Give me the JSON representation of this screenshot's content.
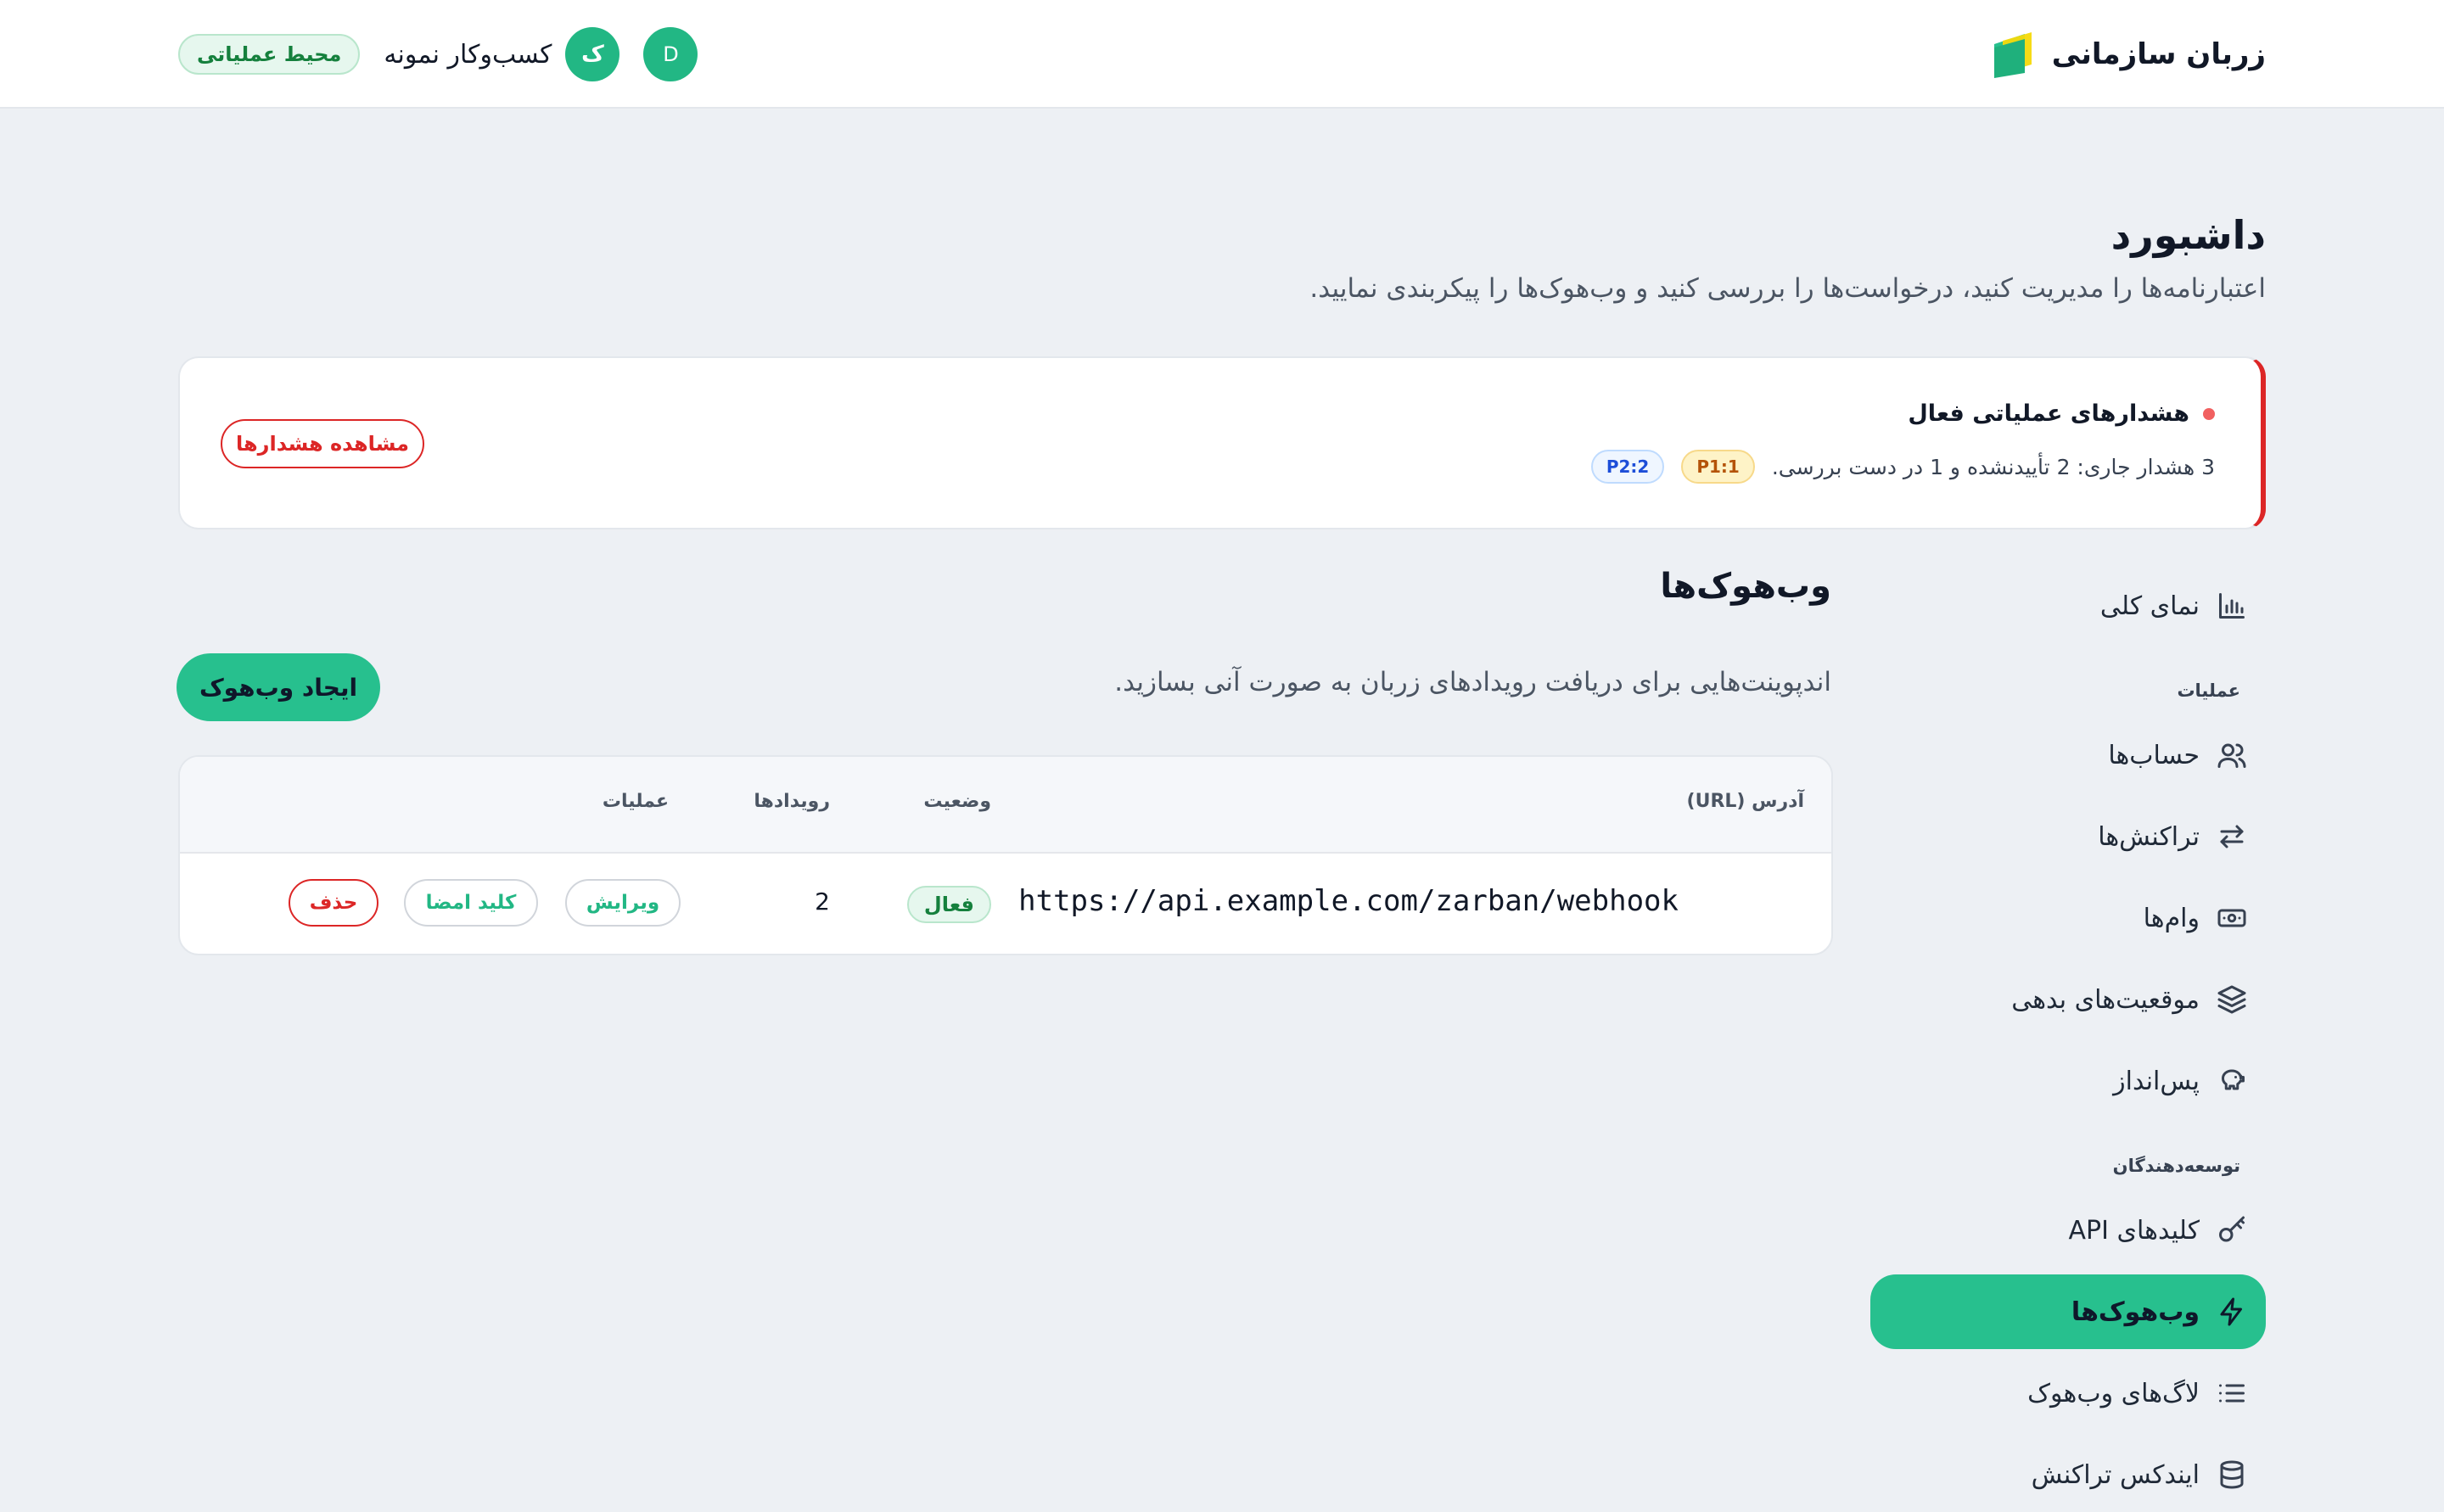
{
  "header": {
    "brand_name": "زربان سازمانی",
    "environment_badge": "محیط عملیاتی",
    "business_avatar": "ک",
    "business_name": "کسب‌وکار نمونه",
    "user_avatar": "D"
  },
  "page": {
    "title": "داشبورد",
    "subtitle": "اعتبارنامه‌ها را مدیریت کنید، درخواست‌ها را بررسی کنید و وب‌هوک‌ها را پیکربندی نمایید."
  },
  "alert": {
    "title": "هشدارهای عملیاتی فعال",
    "text": "3 هشدار جاری: 2 تأییدنشده و 1 در دست بررسی.",
    "chip_p1": "P1:1",
    "chip_p2": "P2:2",
    "button_label": "مشاهده هشدارها"
  },
  "sidebar": {
    "overview": "نمای کلی",
    "section_operations": "عملیات",
    "accounts": "حساب‌ها",
    "transactions": "تراکنش‌ها",
    "loans": "وام‌ها",
    "debt_positions": "موقعیت‌های بدهی",
    "savings": "پس‌انداز",
    "section_developers": "توسعه‌دهندگان",
    "api_keys": "کلیدهای API",
    "webhooks": "وب‌هوک‌ها",
    "webhook_logs": "لاگ‌های وب‌هوک",
    "transaction_index": "ایندکس تراکنش"
  },
  "webhooks": {
    "title": "وب‌هوک‌ها",
    "subtitle": "اندپوینت‌هایی برای دریافت رویدادهای زربان به صورت آنی بسازید.",
    "create_button": "ایجاد وب‌هوک",
    "columns": {
      "url": "آدرس (URL)",
      "status": "وضعیت",
      "events": "رویدادها",
      "actions": "عملیات"
    },
    "rows": [
      {
        "url": "https://api.example.com/zarban/webhook",
        "status": "فعال",
        "events": "2",
        "edit_label": "ویرایش",
        "signing_key_label": "کلید امضا",
        "delete_label": "حذف"
      }
    ]
  },
  "colors": {
    "accent": "#27c08e",
    "danger": "#dc2626",
    "background": "#edf0f4"
  }
}
